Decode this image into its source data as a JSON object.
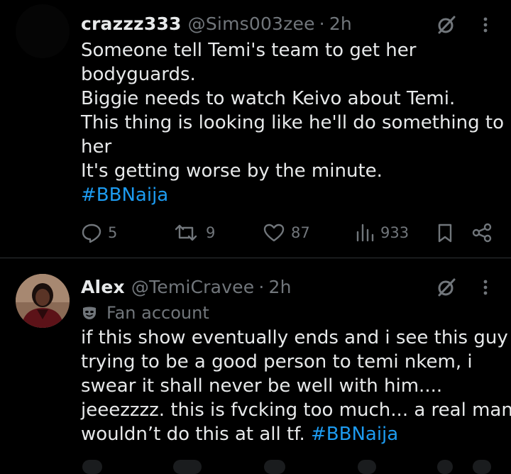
{
  "tweets": [
    {
      "display_name": "crazzz333",
      "handle": "@Sims003zee",
      "separator": "·",
      "time": "2h",
      "lines": [
        "Someone tell Temi's team to get her",
        "bodyguards.",
        "Biggie needs to watch Keivo about Temi.",
        "This thing is looking like he'll do something to",
        "her",
        "It's getting worse by the minute."
      ],
      "hashtag": "#BBNaija",
      "actions": {
        "replies": "5",
        "reposts": "9",
        "likes": "87",
        "views": "933"
      }
    },
    {
      "display_name": "Alex",
      "handle": "@TemiCravee",
      "separator": "·",
      "time": "2h",
      "label_icon": "mask-icon",
      "label": "Fan account",
      "lines": [
        "if this show eventually ends and i see this guy",
        "trying to be a good person to temi nkem, i",
        "swear it shall never be well with him....",
        "jeeezzzz. this is fvcking too much... a real man"
      ],
      "last_line_text": "wouldn’t do this at all tf. ",
      "hashtag": "#BBNaija"
    }
  ],
  "colors": {
    "background": "#000000",
    "text": "#e7e9ea",
    "muted": "#71767b",
    "link": "#1d9bf0",
    "divider": "#2f3336"
  },
  "icons": [
    "grok-icon",
    "more-icon",
    "reply-icon",
    "repost-icon",
    "like-icon",
    "views-icon",
    "bookmark-icon",
    "share-icon",
    "mask-icon"
  ]
}
